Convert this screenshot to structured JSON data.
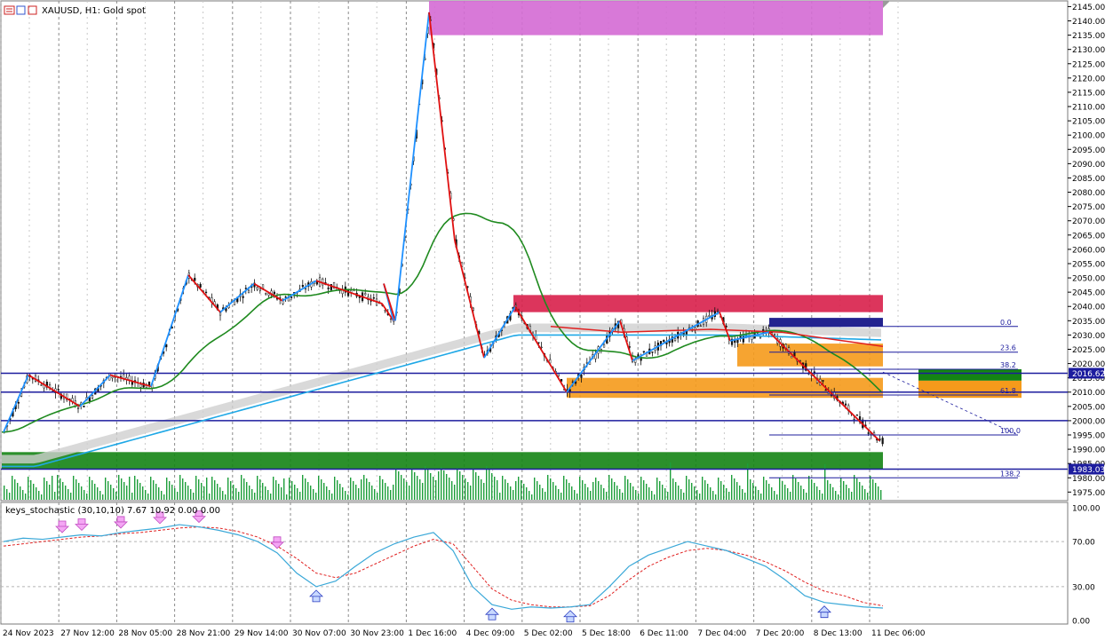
{
  "header": {
    "symbol_title": "XAUUSD, H1:  Gold spot"
  },
  "stoch": {
    "title": "keys_stochastic (30,10,10) 7.67 10.92 0.00 0.00"
  },
  "colors": {
    "up_candle": "#1a1a1a",
    "bull_zigzag": "#1e90ff",
    "bear_zigzag": "#e01010",
    "ma_green": "#1f8a1f",
    "ma_blue": "#1fa8e6",
    "magenta_zone": "#d46ad4",
    "red_zone": "#d81f4a",
    "orange_zone": "#f59a1b",
    "green_zone": "#148414",
    "fib_line": "#1c1c9e",
    "volume": "#1d9e3a"
  },
  "price_axis": {
    "ticks": [
      "2145.00",
      "2140.00",
      "2135.00",
      "2130.00",
      "2125.00",
      "2120.00",
      "2115.00",
      "2110.00",
      "2105.00",
      "2100.00",
      "2095.00",
      "2090.00",
      "2085.00",
      "2080.00",
      "2075.00",
      "2070.00",
      "2065.00",
      "2060.00",
      "2055.00",
      "2050.00",
      "2045.00",
      "2040.00",
      "2035.00",
      "2030.00",
      "2025.00",
      "2020.00",
      "2015.00",
      "2010.00",
      "2005.00",
      "2000.00",
      "1995.00",
      "1990.00",
      "1985.00",
      "1980.00",
      "1975.00"
    ],
    "highlights": [
      {
        "label": "2016.62",
        "color": "#1c1c9e",
        "value": 2016.62
      },
      {
        "label": "1983.03",
        "color": "#1c1c9e",
        "value": 1983.03
      }
    ]
  },
  "stoch_axis": {
    "ticks": [
      "100.00",
      "70.00",
      "30.00",
      "0.00"
    ]
  },
  "time_axis": {
    "labels": [
      "24 Nov 2023",
      "27 Nov 12:00",
      "28 Nov 05:00",
      "28 Nov 21:00",
      "29 Nov 14:00",
      "30 Nov 07:00",
      "30 Nov 23:00",
      "1 Dec 16:00",
      "4 Dec 09:00",
      "5 Dec 02:00",
      "5 Dec 18:00",
      "6 Dec 11:00",
      "7 Dec 04:00",
      "7 Dec 20:00",
      "8 Dec 13:00",
      "11 Dec 06:00"
    ]
  },
  "fib_labels": [
    "0.0",
    "23.6",
    "38.2",
    "61.8",
    "100.0",
    "138.2"
  ],
  "chart_data": {
    "type": "candlestick",
    "title": "XAUUSD, H1:  Gold spot",
    "ylim": [
      1972,
      2147
    ],
    "zigzag_prices": [
      1996,
      2016,
      2005,
      2016,
      2012,
      2051,
      2038,
      2048,
      2042,
      2049,
      2041,
      2035,
      2048,
      2035,
      2143,
      2063,
      2022,
      2040,
      2010,
      2035,
      2021,
      2038,
      2028,
      2031,
      1993
    ],
    "zones": [
      {
        "name": "magenta",
        "from": 2135,
        "to": 2147
      },
      {
        "name": "red",
        "from": 2038,
        "to": 2044
      },
      {
        "name": "orange-upper",
        "from": 2019,
        "to": 2027
      },
      {
        "name": "orange-lower",
        "from": 2008,
        "to": 2015
      },
      {
        "name": "green",
        "from": 1983,
        "to": 1989
      }
    ],
    "fib_levels": [
      {
        "label": "0.0",
        "price": 2033
      },
      {
        "label": "23.6",
        "price": 2024
      },
      {
        "label": "38.2",
        "price": 2018
      },
      {
        "label": "61.8",
        "price": 2009
      },
      {
        "label": "100.0",
        "price": 1995
      },
      {
        "label": "138.2",
        "price": 1980
      }
    ],
    "stochastic": {
      "k": [
        70,
        73,
        72,
        74,
        76,
        75,
        78,
        80,
        82,
        85,
        83,
        80,
        76,
        70,
        60,
        42,
        30,
        35,
        48,
        60,
        68,
        74,
        78,
        62,
        30,
        14,
        10,
        12,
        11,
        12,
        14,
        30,
        48,
        58,
        64,
        70,
        66,
        62,
        55,
        48,
        36,
        22,
        16,
        14,
        12,
        11
      ],
      "d": [
        66,
        68,
        70,
        72,
        74,
        75,
        77,
        78,
        80,
        82,
        83,
        82,
        79,
        74,
        66,
        55,
        42,
        38,
        42,
        50,
        58,
        66,
        72,
        68,
        48,
        28,
        18,
        14,
        12,
        12,
        13,
        22,
        36,
        48,
        56,
        62,
        64,
        62,
        58,
        52,
        44,
        34,
        26,
        22,
        16,
        13
      ]
    }
  }
}
